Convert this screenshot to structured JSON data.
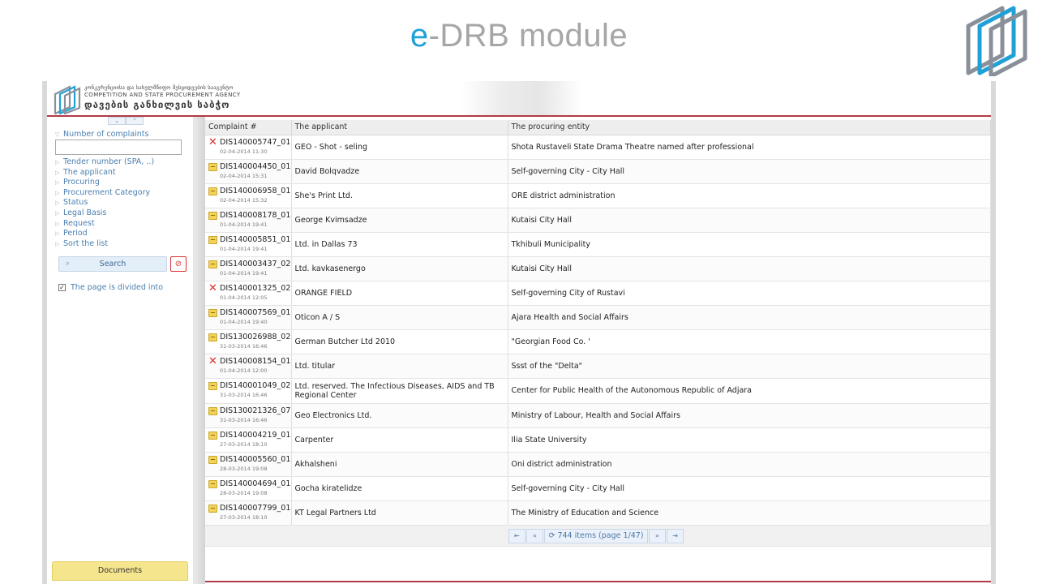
{
  "slide": {
    "title_accent": "e",
    "title_rest": "-DRB module"
  },
  "header": {
    "agency_geo": "კონკურენციისა და სახელმწიფო შესყიდვების სააგენტო",
    "agency_en": "COMPETITION AND STATE PROCUREMENT AGENCY",
    "agency_sub": "დავების განხილვის საბჭო"
  },
  "sidebar": {
    "filter_heading": "Number of complaints",
    "filters": [
      "Tender number (SPA, ..)",
      "The applicant",
      "Procuring",
      "Procurement Category",
      "Status",
      "Legal Basis",
      "Request",
      "Period",
      "Sort the list"
    ],
    "search_label": "Search",
    "clear_glyph": "⊘",
    "paging_label": "The page is divided into",
    "documents_label": "Documents"
  },
  "table": {
    "headers": [
      "Complaint #",
      "The applicant",
      "The procuring entity"
    ],
    "rows": [
      {
        "status": "rejected",
        "id": "DIS140005747_01",
        "date": "02-04-2014 11:30",
        "applicant": "GEO - Shot - seling",
        "entity": "Shota Rustaveli State Drama Theatre named after professional"
      },
      {
        "status": "pending",
        "id": "DIS140004450_01",
        "date": "02-04-2014 15:31",
        "applicant": "David Bolqvadze",
        "entity": "Self-governing City - City Hall"
      },
      {
        "status": "pending",
        "id": "DIS140006958_01",
        "date": "02-04-2014 15:32",
        "applicant": "She's Print Ltd.",
        "entity": "ORE district administration"
      },
      {
        "status": "pending",
        "id": "DIS140008178_01",
        "date": "01-04-2014 19:41",
        "applicant": "George Kvimsadze",
        "entity": "Kutaisi City Hall"
      },
      {
        "status": "pending",
        "id": "DIS140005851_01",
        "date": "01-04-2014 19:41",
        "applicant": "Ltd. in Dallas 73",
        "entity": "Tkhibuli Municipality"
      },
      {
        "status": "pending",
        "id": "DIS140003437_02",
        "date": "01-04-2014 19:41",
        "applicant": "Ltd. kavkasenergo",
        "entity": "Kutaisi City Hall"
      },
      {
        "status": "rejected",
        "id": "DIS140001325_02",
        "date": "01-04-2014 12:05",
        "applicant": "ORANGE FIELD",
        "entity": "Self-governing City of Rustavi"
      },
      {
        "status": "pending",
        "id": "DIS140007569_01",
        "date": "01-04-2014 19:40",
        "applicant": "Oticon A / S",
        "entity": "Ajara Health and Social Affairs"
      },
      {
        "status": "pending",
        "id": "DIS130026988_02",
        "date": "31-03-2014 16:46",
        "applicant": "German Butcher Ltd 2010",
        "entity": "\"Georgian Food Co. '"
      },
      {
        "status": "rejected",
        "id": "DIS140008154_01",
        "date": "01-04-2014 12:00",
        "applicant": "Ltd. titular",
        "entity": "Ssst of the \"Delta\""
      },
      {
        "status": "pending",
        "id": "DIS140001049_02",
        "date": "31-03-2014 16:46",
        "applicant": "Ltd. reserved. The Infectious Diseases, AIDS and TB Regional Center",
        "entity": "Center for Public Health of the Autonomous Republic of Adjara"
      },
      {
        "status": "pending",
        "id": "DIS130021326_07",
        "date": "31-03-2014 16:46",
        "applicant": "Geo Electronics Ltd.",
        "entity": "Ministry of Labour, Health and Social Affairs"
      },
      {
        "status": "pending",
        "id": "DIS140004219_01",
        "date": "27-03-2014 18:10",
        "applicant": "Carpenter",
        "entity": "Ilia State University"
      },
      {
        "status": "pending",
        "id": "DIS140005560_01",
        "date": "28-03-2014 19:08",
        "applicant": "Akhalsheni",
        "entity": "Oni district administration"
      },
      {
        "status": "pending",
        "id": "DIS140004694_01",
        "date": "28-03-2014 19:08",
        "applicant": "Gocha kiratelidze",
        "entity": "Self-governing City - City Hall"
      },
      {
        "status": "pending",
        "id": "DIS140007799_01",
        "date": "27-03-2014 18:10",
        "applicant": "KT Legal Partners Ltd",
        "entity": "The Ministry of Education and Science"
      }
    ]
  },
  "pager": {
    "first": "⇤",
    "prev": "«",
    "info": "744 items (page 1/47)",
    "next": "»",
    "last": "⇥"
  },
  "colors": {
    "accent_blue": "#1fa1d8",
    "title_gray": "#a6a6a6",
    "rule_red": "#b23a48",
    "link_blue": "#4a7fb0",
    "documents_yellow": "#f5e58c"
  }
}
